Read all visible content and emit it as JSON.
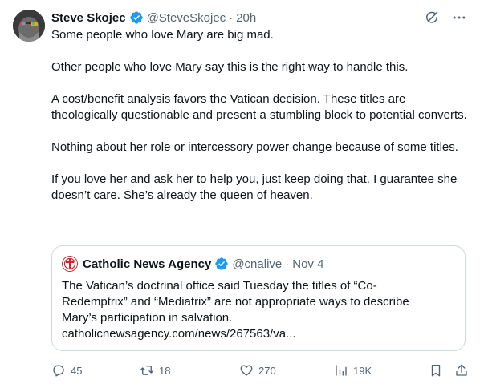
{
  "tweet": {
    "author_name": "Steve Skojec",
    "author_handle": "@SteveSkojec",
    "separator": "·",
    "time": "20h",
    "paragraphs": [
      "Some people who love Mary are big mad.",
      "Other people who love Mary say this is the right way to handle this.",
      "A cost/benefit analysis favors the Vatican decision. These titles are theologically questionable and present a stumbling block to potential converts.",
      "Nothing about her role or intercessory power change because of some titles.",
      "If you love her and ask her to help you, just keep doing that. I guarantee she doesn’t care. She’s already the queen of heaven."
    ]
  },
  "quoted": {
    "author_name": "Catholic News Agency",
    "author_handle": "@cnalive",
    "separator": "·",
    "time": "Nov 4",
    "text": "The Vatican’s doctrinal office said Tuesday the titles of “Co-Redemptrix” and “Mediatrix” are not appropriate ways to describe Mary’s participation in salvation. catholicnewsagency.com/news/267563/va..."
  },
  "actions": {
    "replies": "45",
    "reposts": "18",
    "likes": "270",
    "views": "19K"
  },
  "colors": {
    "verified_blue": "#1d9bf0",
    "secondary_text": "#536471",
    "border": "#cfd9de",
    "cna_red": "#d1232a"
  },
  "icons": [
    "verified-badge-icon",
    "grok-icon",
    "more-icon",
    "reply-icon",
    "repost-icon",
    "like-icon",
    "views-icon",
    "bookmark-icon",
    "share-icon"
  ]
}
